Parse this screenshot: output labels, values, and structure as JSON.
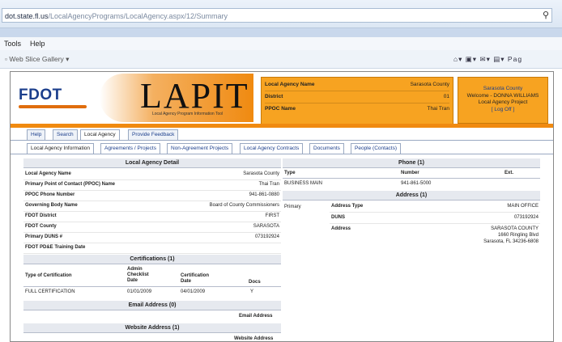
{
  "browser": {
    "address_domain": "dot.state.fl.us",
    "address_path": "/LocalAgencyPrograms/LocalAgency.aspx/12/Summary",
    "menu": [
      "Tools",
      "Help"
    ],
    "favorites_item": "Web Slice Gallery ▾",
    "page_label": "Pag"
  },
  "header": {
    "logo": "FDOT",
    "app_name": "LAPIT",
    "app_subtitle": "Local Agency Program Information Tool",
    "info": {
      "agency_label": "Local Agency Name",
      "agency_value": "Sarasota County",
      "district_label": "District",
      "district_value": "01",
      "ppoc_label": "PPOC Name",
      "ppoc_value": "Thai Tran"
    },
    "welcome": {
      "county": "Sarasota County",
      "welcome_line": "Welcome - DONNA WILLIAMS",
      "project": "Local Agency Project",
      "logoff": "[ Log Off ]"
    }
  },
  "nav": {
    "top": [
      "Help",
      "Search",
      "Local Agency",
      "Provide Feedback"
    ],
    "sub": [
      "Local Agency Information",
      "Agreements / Projects",
      "Non-Agreement Projects",
      "Local Agency Contracts",
      "Documents",
      "People (Contacts)"
    ]
  },
  "detail": {
    "title": "Local Agency Detail",
    "rows": [
      {
        "label": "Local Agency Name",
        "value": "Sarasota County"
      },
      {
        "label": "Primary Point of Contact (PPOC) Name",
        "value": "Thai Tran"
      },
      {
        "label": "PPOC Phone Number",
        "value": "941-861-0880"
      },
      {
        "label": "Governing Body Name",
        "value": "Board of County Commissioners"
      },
      {
        "label": "FDOT District",
        "value": "FIRST"
      },
      {
        "label": "FDOT County",
        "value": "SARASOTA"
      },
      {
        "label": "Primary DUNS #",
        "value": "073192924"
      },
      {
        "label": "FDOT PD&E Training Date",
        "value": ""
      }
    ]
  },
  "certifications": {
    "title": "Certifications (1)",
    "col_type": "Type of Certification",
    "col_admin": "Admin Checklist Date",
    "col_cert": "Certification Date",
    "col_docs": "Docs",
    "row": {
      "type": "FULL CERTIFICATION",
      "admin": "01/01/2009",
      "cert": "04/01/2009",
      "docs": "Y"
    }
  },
  "email": {
    "title": "Email Address (0)",
    "col": "Email Address"
  },
  "website": {
    "title": "Website Address (1)",
    "col": "Website Address"
  },
  "phone": {
    "title": "Phone (1)",
    "col_type": "Type",
    "col_number": "Number",
    "col_ext": "Ext.",
    "row": {
      "type": "BUSINESS MAIN",
      "number": "941-861-5000",
      "ext": ""
    }
  },
  "address": {
    "title": "Address (1)",
    "primary": "Primary",
    "type_label": "Address Type",
    "type_value": "MAIN OFFICE",
    "duns_label": "DUNS",
    "duns_value": "073192924",
    "addr_label": "Address",
    "addr_line1": "SARASOTA COUNTY",
    "addr_line2": "1660 Ringling Blvd",
    "addr_line3": "Sarasota, FL 34236-6808"
  }
}
